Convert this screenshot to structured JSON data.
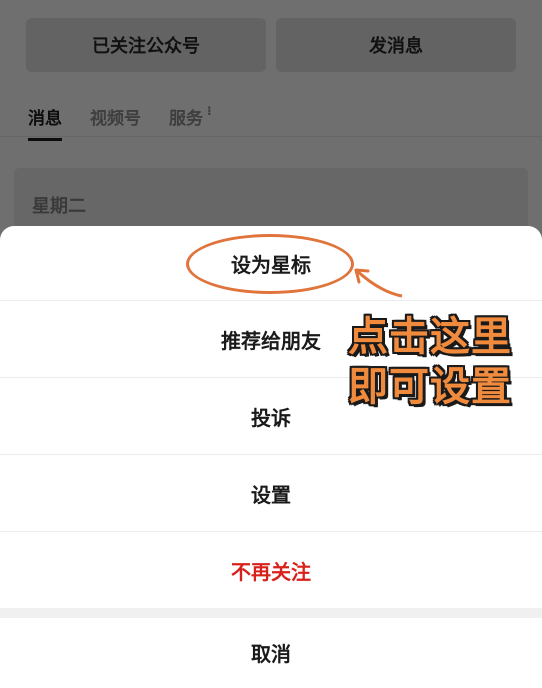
{
  "header": {
    "buttons": [
      "已关注公众号",
      "发消息"
    ]
  },
  "tabs": [
    {
      "label": "消息",
      "active": true
    },
    {
      "label": "视频号",
      "active": false
    },
    {
      "label": "服务",
      "active": false
    }
  ],
  "feed": {
    "day_label": "星期二"
  },
  "action_sheet": {
    "items": [
      "设为星标",
      "推荐给朋友",
      "投诉",
      "设置",
      "不再关注"
    ],
    "cancel_label": "取消",
    "danger_color": "#d9211c"
  },
  "annotation": {
    "line1": "点击这里",
    "line2": "即可设置",
    "color": "#f08a3c",
    "highlight_color": "#e0743a"
  }
}
